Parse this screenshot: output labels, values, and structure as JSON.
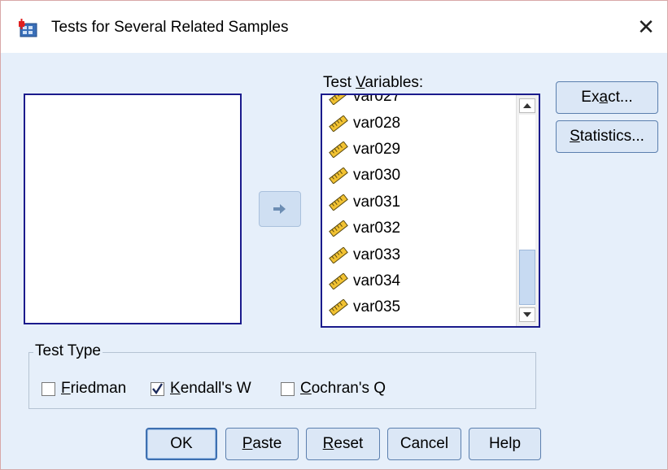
{
  "window": {
    "title": "Tests for Several Related Samples",
    "close_label": "✕"
  },
  "target": {
    "label_prefix": "Test ",
    "label_underlined": "V",
    "label_suffix": "ariables:",
    "items": [
      "var027",
      "var028",
      "var029",
      "var030",
      "var031",
      "var032",
      "var033",
      "var034",
      "var035"
    ],
    "item_icon": "ruler-icon"
  },
  "side_buttons": {
    "exact": {
      "pre": "Ex",
      "u": "a",
      "post": "ct..."
    },
    "statistics": {
      "pre": "",
      "u": "S",
      "post": "tatistics..."
    }
  },
  "test_type": {
    "label": "Test Type",
    "friedman": {
      "u": "F",
      "post": "riedman",
      "checked": false
    },
    "kendall": {
      "u": "K",
      "post": "endall's W",
      "checked": true
    },
    "cochran": {
      "u": "C",
      "post": "ochran's Q",
      "checked": false
    }
  },
  "bottom_buttons": {
    "ok": "OK",
    "paste": {
      "u": "P",
      "post": "aste"
    },
    "reset": {
      "u": "R",
      "post": "eset"
    },
    "cancel": "Cancel",
    "help": "Help"
  },
  "colors": {
    "client_bg": "#e6effa",
    "list_border": "#1b1b8c",
    "button_bg": "#dbe7f6"
  }
}
